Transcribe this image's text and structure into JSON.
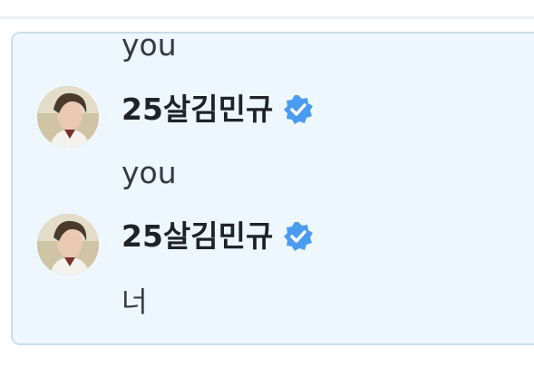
{
  "thread": {
    "top_partial_text": "you",
    "messages": [
      {
        "author": "25살김민규",
        "verified_badge_icon": "verified-check-icon",
        "text": "you"
      },
      {
        "author": "25살김민규",
        "verified_badge_icon": "verified-check-icon",
        "text": "너"
      }
    ]
  },
  "colors": {
    "card_background": "#eef7fe",
    "card_border": "#c9dde9",
    "badge_blue": "#4a9cf0",
    "text": "#333a42",
    "username_text": "#1f2328"
  }
}
